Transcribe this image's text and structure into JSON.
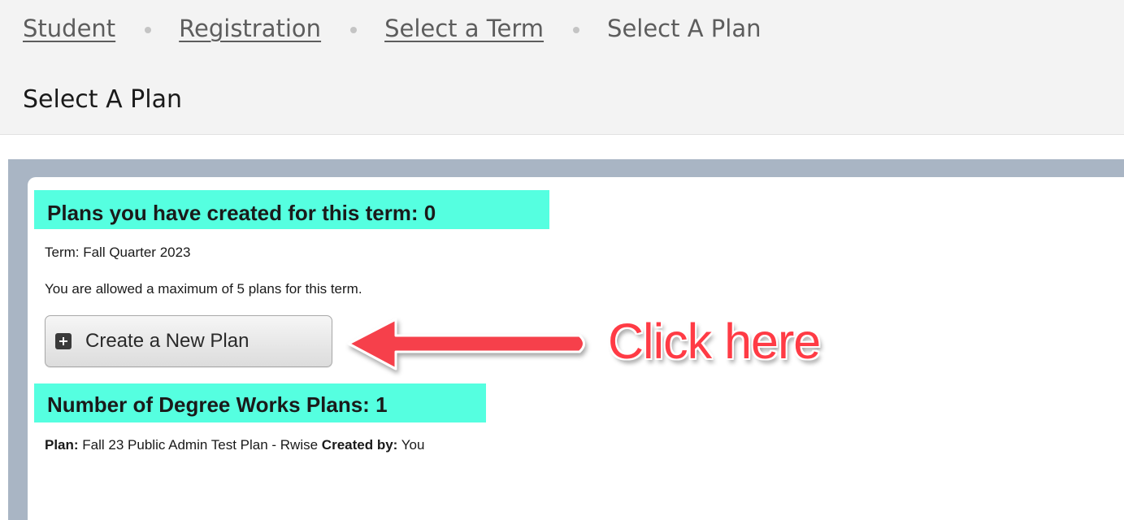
{
  "breadcrumb": {
    "items": [
      {
        "label": "Student"
      },
      {
        "label": "Registration"
      },
      {
        "label": "Select a Term"
      }
    ],
    "current": "Select A Plan"
  },
  "page": {
    "title": "Select A Plan"
  },
  "plans_section": {
    "heading": "Plans you have created for this term: 0",
    "term_text": "Term: Fall Quarter 2023",
    "max_text": "You are allowed a maximum of 5 plans for this term.",
    "create_button_label": "Create a New Plan",
    "create_button_icon": "plus-square-icon"
  },
  "degree_works": {
    "heading": "Number of Degree Works Plans: 1",
    "plan_label": "Plan:",
    "plan_name": "Fall 23 Public Admin Test Plan - Rwise",
    "created_by_label": "Created by:",
    "created_by_value": "You"
  },
  "annotation": {
    "callout_text": "Click here",
    "arrow_color": "#ff3b45",
    "highlight_color": "#55ffe0"
  }
}
